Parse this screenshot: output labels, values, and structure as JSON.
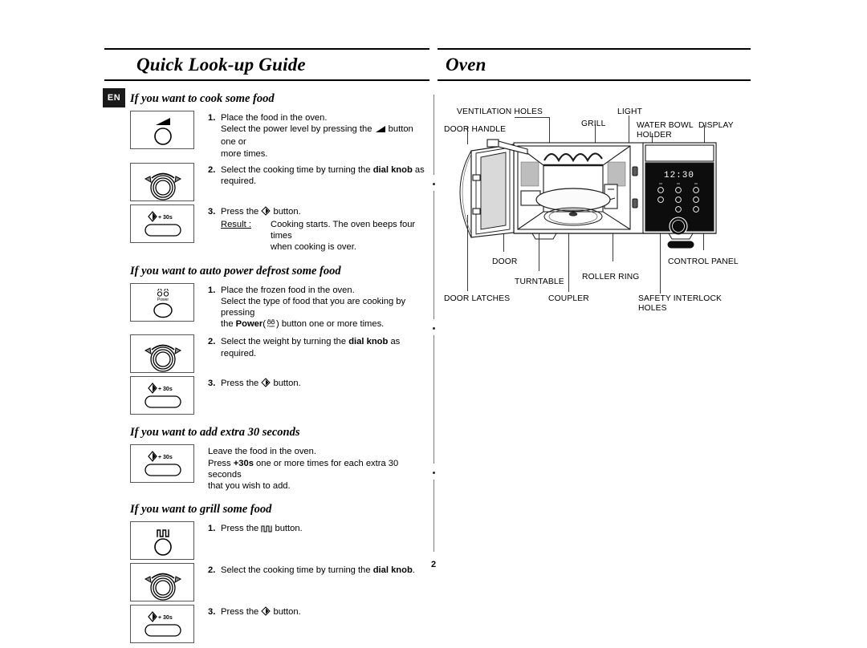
{
  "document": {
    "page_number": "2",
    "language_badge": "EN"
  },
  "left_column": {
    "title": "Quick Look-up Guide",
    "sections": [
      {
        "id": "cook",
        "heading": "If you want to cook some food",
        "steps": [
          {
            "icon": "power-level-button-icon",
            "number": "1.",
            "lines": [
              "Place the food in the oven.",
              "Select the power level by pressing the  ◢  button one or more times."
            ],
            "line1": "Place the food in the oven.",
            "line2_a": "Select the power level by pressing the",
            "line2_b": "button one or",
            "line3": "more times."
          },
          {
            "icon": "dial-knob-icon",
            "number": "2.",
            "line1_a": "Select the cooking time by turning the",
            "line1_b": "dial knob",
            "line1_c": "as",
            "line2": "required."
          },
          {
            "icon": "start-plus-30s-button-icon",
            "number": "3.",
            "line1_a": "Press the",
            "line1_b": "button.",
            "result_label": "Result :",
            "result_line1": "Cooking starts. The oven beeps four times",
            "result_line2": "when cooking is over."
          }
        ]
      },
      {
        "id": "defrost",
        "heading": "If you want to auto power defrost some food",
        "steps": [
          {
            "icon": "power-button-icon",
            "number": "1.",
            "line1": "Place the frozen food in the oven.",
            "line2": "Select the type of food that you are cooking by pressing",
            "line3_a": "the",
            "line3_b": "Power",
            "line3_c": "(",
            "line3_d": ") button one or more times."
          },
          {
            "icon": "dial-knob-icon",
            "number": "2.",
            "line1_a": "Select the weight by turning the",
            "line1_b": "dial knob",
            "line1_c": "as required."
          },
          {
            "icon": "start-plus-30s-button-icon",
            "number": "3.",
            "line1_a": "Press the",
            "line1_b": "button."
          }
        ]
      },
      {
        "id": "extra30",
        "heading": "If you want to add extra 30 seconds",
        "steps": [
          {
            "icon": "start-plus-30s-button-icon",
            "number": "",
            "line1": "Leave the food in the oven.",
            "line2_a": "Press",
            "line2_b": "+30s",
            "line2_c": "one or more times for each extra 30 seconds",
            "line3": "that you wish to add."
          }
        ]
      },
      {
        "id": "grill",
        "heading": "If you want to grill some food",
        "steps": [
          {
            "icon": "grill-button-icon",
            "number": "1.",
            "line1_a": "Press the",
            "line1_b": "button."
          },
          {
            "icon": "dial-knob-icon",
            "number": "2.",
            "line1_a": "Select the cooking time by turning the",
            "line1_b": "dial knob",
            "line1_c": "."
          },
          {
            "icon": "start-plus-30s-button-icon",
            "number": "3.",
            "line1_a": "Press the",
            "line1_b": "button."
          }
        ]
      }
    ]
  },
  "right_column": {
    "title": "Oven",
    "diagram": {
      "name": "microwave-oven-cutaway-diagram",
      "display_text": "12:30",
      "labels": [
        {
          "id": "ventilation-holes",
          "text": "VENTILATION HOLES"
        },
        {
          "id": "light",
          "text": "LIGHT"
        },
        {
          "id": "door-handle",
          "text": "DOOR HANDLE"
        },
        {
          "id": "grill",
          "text": "GRILL"
        },
        {
          "id": "water-bowl-holder-1",
          "text": "WATER BOWL"
        },
        {
          "id": "water-bowl-holder-2",
          "text": "HOLDER"
        },
        {
          "id": "display",
          "text": "DISPLAY"
        },
        {
          "id": "door",
          "text": "DOOR"
        },
        {
          "id": "roller-ring",
          "text": "ROLLER RING"
        },
        {
          "id": "control-panel",
          "text": "CONTROL PANEL"
        },
        {
          "id": "turntable",
          "text": "TURNTABLE"
        },
        {
          "id": "door-latches",
          "text": "DOOR LATCHES"
        },
        {
          "id": "coupler",
          "text": "COUPLER"
        },
        {
          "id": "safety-interlock-1",
          "text": "SAFETY INTERLOCK"
        },
        {
          "id": "safety-interlock-2",
          "text": "HOLES"
        }
      ]
    }
  },
  "colors": {
    "ink": "#000000",
    "rule": "#000000",
    "badge_bg": "#1a1a1a",
    "door_glass": "#d9d9d9",
    "panel_black": "#0d0d0d"
  }
}
